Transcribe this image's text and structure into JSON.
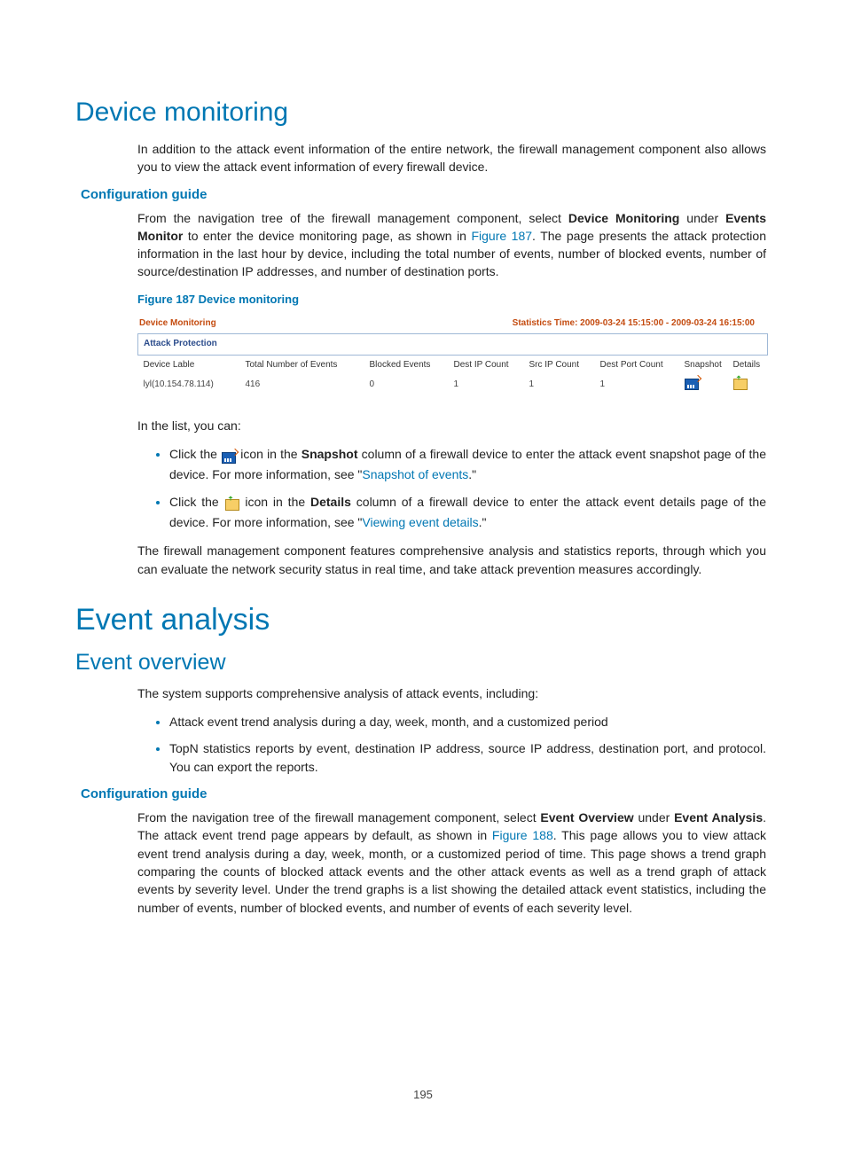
{
  "page_number": "195",
  "device_monitoring": {
    "heading": "Device monitoring",
    "intro": "In addition to the attack event information of the entire network, the firewall management component also allows you to view the attack event information of every firewall device.",
    "config_heading": "Configuration guide",
    "config_p_pre": "From the navigation tree of the firewall management component, select ",
    "config_bold1": "Device Monitoring",
    "config_mid1": " under ",
    "config_bold2": "Events Monitor",
    "config_mid2": " to enter the device monitoring page, as shown in ",
    "config_link": "Figure 187",
    "config_post": ". The page presents the attack protection information in the last hour by device, including the total number of events, number of blocked events, number of source/destination IP addresses, and number of destination ports.",
    "figcap": "Figure 187 Device monitoring",
    "figure": {
      "title_left": "Device Monitoring",
      "title_right": "Statistics Time: 2009-03-24 15:15:00 - 2009-03-24 16:15:00",
      "section": "Attack Protection",
      "headers": [
        "Device Lable",
        "Total Number of Events",
        "Blocked Events",
        "Dest IP Count",
        "Src IP Count",
        "Dest Port Count",
        "Snapshot",
        "Details"
      ],
      "row": {
        "device": "lyl(10.154.78.114)",
        "total": "416",
        "blocked": "0",
        "destip": "1",
        "srcip": "1",
        "destport": "1"
      }
    },
    "list_intro": "In the list, you can:",
    "bullet1_pre": "Click the ",
    "bullet1_mid1": " icon in the ",
    "bullet1_bold": "Snapshot",
    "bullet1_mid2": " column of a firewall device to enter the attack event snapshot page of the device. For more information, see \"",
    "bullet1_link": "Snapshot of events",
    "bullet1_post": ".\"",
    "bullet2_pre": "Click the ",
    "bullet2_mid1": " icon in the ",
    "bullet2_bold": "Details",
    "bullet2_mid2": " column of a firewall device to enter the attack event details page of the device. For more information, see \"",
    "bullet2_link": "Viewing event details",
    "bullet2_post": ".\"",
    "closing": "The firewall management component features comprehensive analysis and statistics reports, through which you can evaluate the network security status in real time, and take attack prevention measures accordingly."
  },
  "event_analysis": {
    "heading": "Event analysis",
    "overview_heading": "Event overview",
    "intro": "The system supports comprehensive analysis of attack events, including:",
    "b1": "Attack event trend analysis during a day, week, month, and a customized period",
    "b2": "TopN statistics reports by event, destination IP address, source IP address, destination port, and protocol. You can export the reports.",
    "config_heading": "Configuration guide",
    "p_pre": "From the navigation tree of the firewall management component, select ",
    "bold1": "Event Overview",
    "mid1": " under ",
    "bold2": "Event Analysis",
    "mid2": ". The attack event trend page appears by default, as shown in ",
    "link": "Figure 188",
    "post": ". This page allows you to view attack event trend analysis during a day, week, month, or a customized period of time. This page shows a trend graph comparing the counts of blocked attack events and the other attack events as well as a trend graph of attack events by severity level. Under the trend graphs is a list showing the detailed attack event statistics, including the number of events, number of blocked events, and number of events of each severity level."
  }
}
